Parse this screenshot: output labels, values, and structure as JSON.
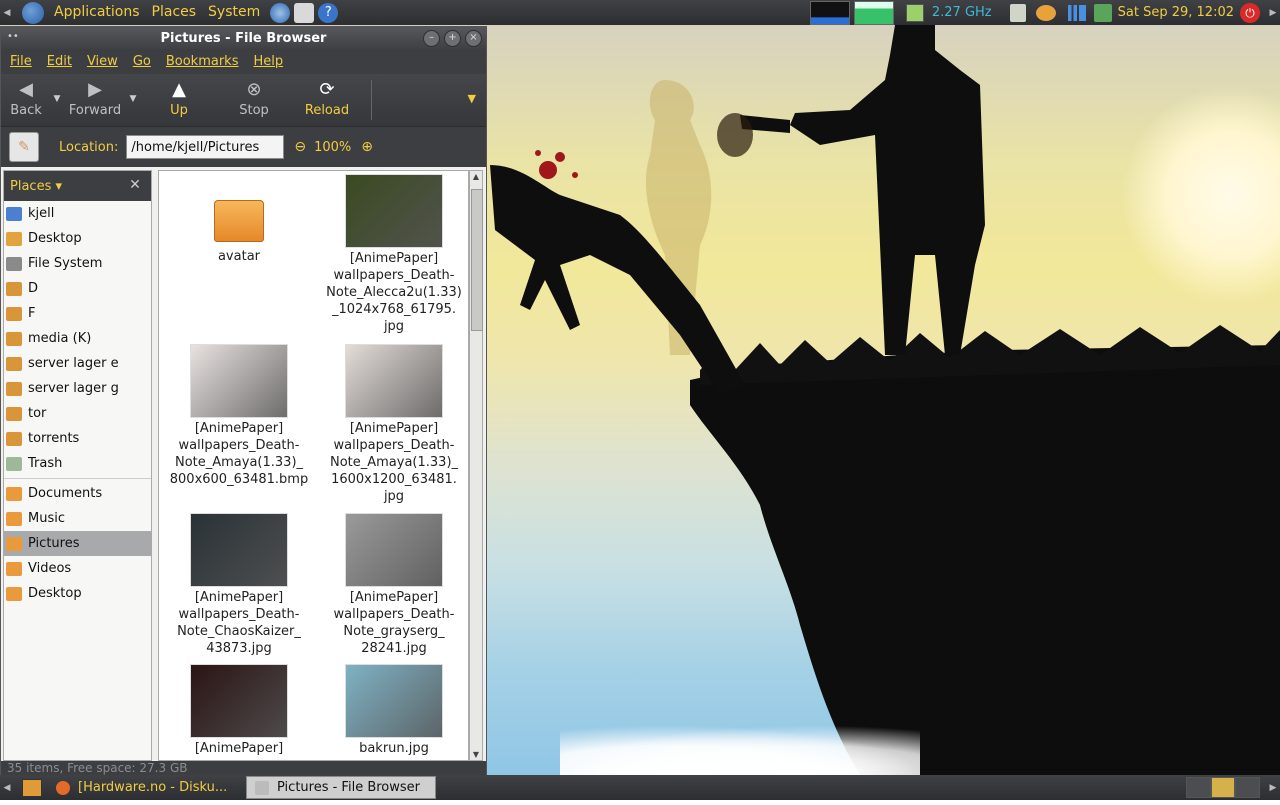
{
  "top_panel": {
    "menus": [
      "Applications",
      "Places",
      "System"
    ],
    "cpu_freq": "2.27 GHz",
    "clock": "Sat Sep 29, 12:02",
    "icons": [
      "gnome-foot-icon",
      "browser-icon",
      "mail-icon",
      "help-icon",
      "cpu-graph-icon",
      "memory-graph-icon",
      "battery-icon",
      "trash-icon",
      "update-icon",
      "signal-icon",
      "network-icon",
      "power-icon"
    ]
  },
  "window": {
    "title": "Pictures - File Browser",
    "menu": [
      "File",
      "Edit",
      "View",
      "Go",
      "Bookmarks",
      "Help"
    ],
    "toolbar": {
      "back": "Back",
      "forward": "Forward",
      "up": "Up",
      "stop": "Stop",
      "reload": "Reload"
    },
    "location_label": "Location:",
    "location_value": "/home/kjell/Pictures",
    "zoom": "100%",
    "places_label": "Places",
    "status": "35 items, Free space: 27.3 GB"
  },
  "sidebar": {
    "items": [
      {
        "label": "kjell",
        "icon": "home-icon"
      },
      {
        "label": "Desktop",
        "icon": "desktop-icon"
      },
      {
        "label": "File System",
        "icon": "filesystem-icon"
      },
      {
        "label": "D",
        "icon": "drive-icon"
      },
      {
        "label": "F",
        "icon": "drive-icon"
      },
      {
        "label": "media (K)",
        "icon": "drive-icon"
      },
      {
        "label": "server lager e",
        "icon": "drive-icon"
      },
      {
        "label": "server lager g",
        "icon": "drive-icon"
      },
      {
        "label": "tor",
        "icon": "drive-icon"
      },
      {
        "label": "torrents",
        "icon": "drive-icon"
      },
      {
        "label": "Trash",
        "icon": "trash-icon"
      }
    ],
    "bookmarks": [
      {
        "label": "Documents",
        "icon": "folder-icon"
      },
      {
        "label": "Music",
        "icon": "folder-icon"
      },
      {
        "label": "Pictures",
        "icon": "folder-icon",
        "selected": true
      },
      {
        "label": "Videos",
        "icon": "folder-icon"
      },
      {
        "label": "Desktop",
        "icon": "folder-icon"
      }
    ]
  },
  "files": [
    {
      "name": "avatar",
      "kind": "folder"
    },
    {
      "name": "[AnimePaper]\nwallpapers_Death-\nNote_Alecca2u(1.33)\n_1024x768_61795.\njpg",
      "kind": "image",
      "color": "#3b4a22"
    },
    {
      "name": "[AnimePaper]\nwallpapers_Death-\nNote_Amaya(1.33)_\n800x600_63481.bmp",
      "kind": "image",
      "color": "#e8e2e0"
    },
    {
      "name": "[AnimePaper]\nwallpapers_Death-\nNote_Amaya(1.33)_\n1600x1200_63481.\njpg",
      "kind": "image",
      "color": "#e3dcd8"
    },
    {
      "name": "[AnimePaper]\nwallpapers_Death-\nNote_ChaosKaizer_\n43873.jpg",
      "kind": "image",
      "color": "#2a3237"
    },
    {
      "name": "[AnimePaper]\nwallpapers_Death-\nNote_grayserg_\n28241.jpg",
      "kind": "image",
      "color": "#9a9a9a"
    },
    {
      "name": "[AnimePaper]",
      "kind": "image",
      "color": "#2b1414"
    },
    {
      "name": "bakrun.jpg",
      "kind": "image",
      "color": "#7fb2c4"
    }
  ],
  "bottom_panel": {
    "tasks": [
      {
        "label": "[Hardware.no - Disku...",
        "icon": "firefox-icon",
        "active": false
      },
      {
        "label": "Pictures - File Browser",
        "icon": "file-browser-icon",
        "active": true
      }
    ]
  },
  "colors": {
    "accent": "#f2cd43",
    "panel": "#3c3e42",
    "selected": "#a8a9ab"
  }
}
